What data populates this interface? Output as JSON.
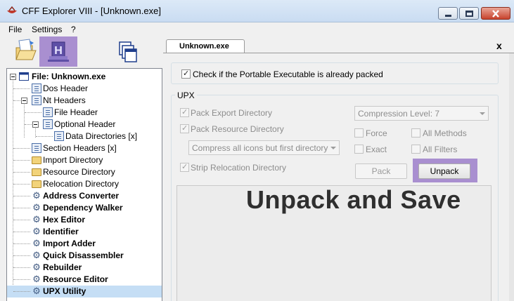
{
  "window": {
    "title": "CFF Explorer VIII - [Unknown.exe]",
    "controls": [
      "minimize",
      "maximize",
      "close"
    ]
  },
  "menu": {
    "items": [
      "File",
      "Settings",
      "?"
    ]
  },
  "toolbar": {
    "buttons": [
      {
        "name": "open-file",
        "icon": "open-folder-icon"
      },
      {
        "name": "h-tool",
        "icon": "h-badge-icon",
        "highlighted": true
      },
      {
        "name": "windows",
        "icon": "windows-stack-icon"
      }
    ],
    "highlight_color": "#a98fd0"
  },
  "tree": {
    "items": [
      {
        "label": "File: Unknown.exe",
        "bold": true,
        "icon": "window-icon"
      },
      {
        "label": "Dos Header",
        "bold": false,
        "icon": "document-icon"
      },
      {
        "label": "Nt Headers",
        "bold": false,
        "icon": "document-icon"
      },
      {
        "label": "File Header",
        "bold": false,
        "icon": "document-icon"
      },
      {
        "label": "Optional Header",
        "bold": false,
        "icon": "document-icon"
      },
      {
        "label": "Data Directories [x]",
        "bold": false,
        "icon": "document-icon"
      },
      {
        "label": "Section Headers [x]",
        "bold": false,
        "icon": "document-icon"
      },
      {
        "label": "Import Directory",
        "bold": false,
        "icon": "folder-icon"
      },
      {
        "label": "Resource Directory",
        "bold": false,
        "icon": "folder-icon"
      },
      {
        "label": "Relocation Directory",
        "bold": false,
        "icon": "folder-icon"
      },
      {
        "label": "Address Converter",
        "bold": true,
        "icon": "tool-icon"
      },
      {
        "label": "Dependency Walker",
        "bold": true,
        "icon": "tool-icon"
      },
      {
        "label": "Hex Editor",
        "bold": true,
        "icon": "tool-icon"
      },
      {
        "label": "Identifier",
        "bold": true,
        "icon": "tool-icon"
      },
      {
        "label": "Import Adder",
        "bold": true,
        "icon": "tool-icon"
      },
      {
        "label": "Quick Disassembler",
        "bold": true,
        "icon": "tool-icon"
      },
      {
        "label": "Rebuilder",
        "bold": true,
        "icon": "tool-icon"
      },
      {
        "label": "Resource Editor",
        "bold": true,
        "icon": "tool-icon"
      },
      {
        "label": "UPX Utility",
        "bold": true,
        "icon": "tool-icon",
        "selected": true
      }
    ]
  },
  "tab": {
    "label": "Unknown.exe",
    "close": "x"
  },
  "packed_check": {
    "label": "Check if the Portable Executable is already packed",
    "checked": true
  },
  "upx": {
    "group_title": "UPX",
    "pack_export": {
      "label": "Pack Export Directory",
      "checked": true
    },
    "pack_resource": {
      "label": "Pack Resource Directory",
      "checked": true
    },
    "compress_icons": {
      "value": "Compress all icons but first directory"
    },
    "strip_relocation": {
      "label": "Strip Relocation Directory",
      "checked": true
    },
    "compression_level": {
      "value": "Compression Level: 7"
    },
    "force": {
      "label": "Force",
      "checked": false
    },
    "exact": {
      "label": "Exact",
      "checked": false
    },
    "all_methods": {
      "label": "All Methods",
      "checked": false
    },
    "all_filters": {
      "label": "All Filters",
      "checked": false
    },
    "pack_button": "Pack",
    "unpack_button": "Unpack"
  },
  "annotation": {
    "text": "Unpack and Save",
    "highlight_color": "#a98fd0"
  }
}
